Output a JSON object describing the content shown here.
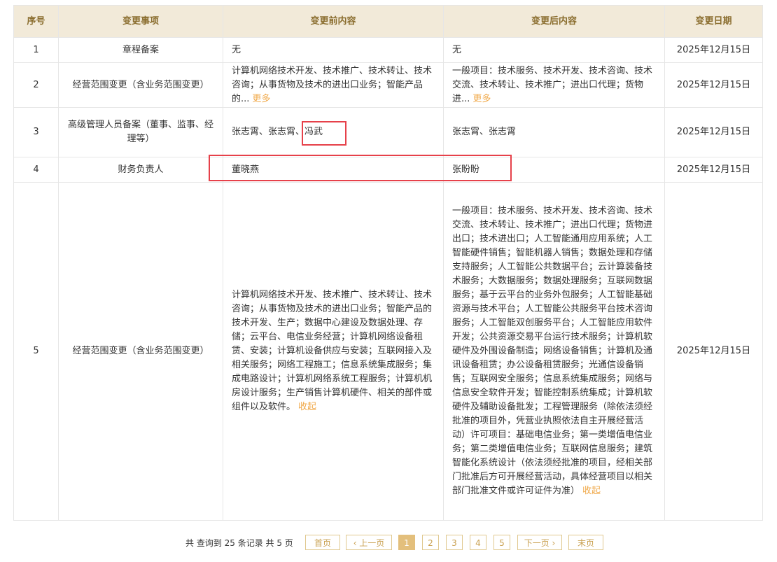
{
  "headers": [
    "序号",
    "变更事项",
    "变更前内容",
    "变更后内容",
    "变更日期"
  ],
  "rows": [
    {
      "no": "1",
      "item": "章程备案",
      "before": "无",
      "before_more": "",
      "after": "无",
      "after_more": "",
      "date": "2025年12月15日"
    },
    {
      "no": "2",
      "item": "经营范围变更（含业务范围变更）",
      "before": "计算机网络技术开发、技术推广、技术转让、技术咨询；从事货物及技术的进出口业务；智能产品的...",
      "before_more": "更多",
      "after": "一般项目：技术服务、技术开发、技术咨询、技术交流、技术转让、技术推广；进出口代理；货物进...",
      "after_more": "更多",
      "date": "2025年12月15日"
    },
    {
      "no": "3",
      "item": "高级管理人员备案（董事、监事、经理等）",
      "before": "张志霄、张志霄、冯武",
      "before_more": "",
      "after": "张志霄、张志霄",
      "after_more": "",
      "date": "2025年12月15日"
    },
    {
      "no": "4",
      "item": "财务负责人",
      "before": "董晓燕",
      "before_more": "",
      "after": "张盼盼",
      "after_more": "",
      "date": "2025年12月15日"
    },
    {
      "no": "5",
      "item": "经营范围变更（含业务范围变更）",
      "before": "计算机网络技术开发、技术推广、技术转让、技术咨询；从事货物及技术的进出口业务；智能产品的技术开发、生产；数据中心建设及数据处理、存储；云平台、电信业务经营；计算机网络设备租赁、安装；计算机设备供应与安装；互联网接入及相关服务；网络工程施工；信息系统集成服务；集成电路设计；计算机网络系统工程服务；计算机机房设计服务；生产销售计算机硬件、相关的部件或组件以及软件。",
      "before_more": "收起",
      "after": "一般项目：技术服务、技术开发、技术咨询、技术交流、技术转让、技术推广；进出口代理；货物进出口；技术进出口；人工智能通用应用系统；人工智能硬件销售；智能机器人销售；数据处理和存储支持服务；人工智能公共数据平台；云计算装备技术服务；大数据服务；数据处理服务；互联网数据服务；基于云平台的业务外包服务；人工智能基础资源与技术平台；人工智能公共服务平台技术咨询服务；人工智能双创服务平台；人工智能应用软件开发；公共资源交易平台运行技术服务；计算机软硬件及外围设备制造；网络设备销售；计算机及通讯设备租赁；办公设备租赁服务；光通信设备销售；互联网安全服务；信息系统集成服务；网络与信息安全软件开发；智能控制系统集成；计算机软硬件及辅助设备批发；工程管理服务（除依法须经批准的项目外，凭营业执照依法自主开展经营活动）许可项目：基础电信业务；第一类增值电信业务；第二类增值电信业务；互联网信息服务；建筑智能化系统设计（依法须经批准的项目，经相关部门批准后方可开展经营活动，具体经营项目以相关部门批准文件或许可证件为准）",
      "after_more": "收起",
      "date": "2025年12月15日"
    }
  ],
  "pagination": {
    "total_text": "共 查询到 25 条记录 共 5 页",
    "first": "首页",
    "prev": "‹ 上一页",
    "pages": [
      "1",
      "2",
      "3",
      "4",
      "5"
    ],
    "current": "1",
    "next": "下一页 ›",
    "last": "末页"
  },
  "colors": {
    "header_bg": "#f2ead9",
    "header_text": "#8a6d2e",
    "link": "#f0a94a",
    "highlight": "#e6414a",
    "page_active": "#e3bf7c"
  }
}
